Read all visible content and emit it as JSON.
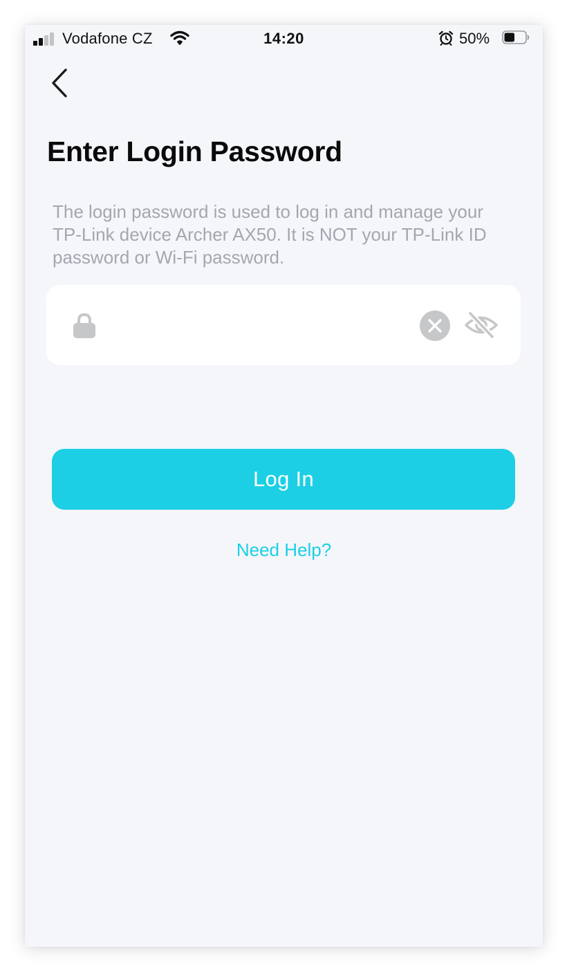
{
  "status_bar": {
    "carrier": "Vodafone CZ",
    "time": "14:20",
    "battery_percent": "50%",
    "battery_level": 0.5,
    "signal_bars_filled": 2,
    "signal_bars_total": 4,
    "icons": [
      "signal-icon",
      "wifi-icon",
      "alarm-icon",
      "battery-icon"
    ]
  },
  "nav": {
    "back_icon": "chevron-left-icon"
  },
  "page": {
    "title": "Enter Login Password",
    "description": "The login password is used to log in and manage your TP-Link device Archer AX50. It is NOT your TP-Link ID password or Wi-Fi password."
  },
  "password_field": {
    "value": "",
    "placeholder": "",
    "icons": [
      "lock-icon",
      "clear-icon",
      "eye-off-icon"
    ]
  },
  "actions": {
    "login_label": "Log In",
    "help_label": "Need Help?"
  },
  "colors": {
    "accent": "#1ccfe4",
    "background": "#f4f6fa",
    "field_background": "#ffffff",
    "description_text": "#a3a7ae",
    "icon_gray": "#c6c7c9"
  }
}
